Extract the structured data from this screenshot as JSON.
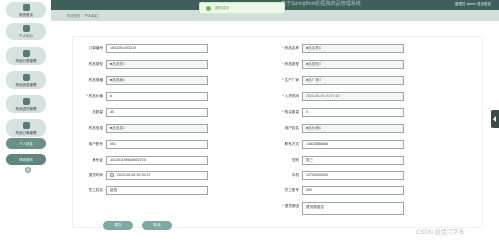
{
  "app": {
    "title": "基于SpringBoot的医院药品管理系统"
  },
  "topbar": {
    "right_text": "管理员 admin  退出登录"
  },
  "breadcrumb": {
    "home": "系统首页",
    "current": "个人中心"
  },
  "toast": {
    "message": "操作成功"
  },
  "sidebar": {
    "items": [
      {
        "label": "系统首页",
        "icon": "home-icon"
      },
      {
        "label": "个人中心",
        "icon": "user-icon"
      },
      {
        "label": "药品分类管理",
        "icon": "category-icon"
      },
      {
        "label": "药品信息管理",
        "icon": "medicine-icon"
      },
      {
        "label": "药品进货管理",
        "icon": "stock-icon"
      },
      {
        "label": "药品订单管理",
        "icon": "order-icon"
      }
    ],
    "sub_items": [
      {
        "label": "个人信息"
      },
      {
        "label": "修改密码"
      }
    ]
  },
  "form": {
    "left": [
      {
        "label": "订单编号",
        "value": "1603201403219",
        "disabled": false
      },
      {
        "label": "药品类型",
        "value": "■品类型1",
        "disabled": true
      },
      {
        "label": "药品规格",
        "value": "■品规格1",
        "disabled": true
      },
      {
        "label": "* 药品价格",
        "value": "6",
        "disabled": false
      },
      {
        "label": "总数量",
        "value": "30",
        "disabled": false
      },
      {
        "label": "药品信息",
        "value": "■品信息1",
        "disabled": true
      },
      {
        "label": "用户账号",
        "value": "001",
        "disabled": false
      },
      {
        "label": "身份证",
        "value": "441301199605002710",
        "disabled": false
      },
      {
        "label": "退货时间",
        "value": "2023-05-05 20:39:37",
        "disabled": false,
        "calendar": true
      },
      {
        "label": "员工姓名",
        "value": "赵四",
        "disabled": false
      }
    ],
    "right": [
      {
        "label": "* 药品名称",
        "value": "■品名称6",
        "disabled": true
      },
      {
        "label": "* 药品类型",
        "value": "■品类型4",
        "disabled": true
      },
      {
        "label": "* 生产厂家",
        "value": "■品厂家4",
        "disabled": true
      },
      {
        "label": "* 入货时间",
        "value": "2023-05-05 20:57:43",
        "disabled": true
      },
      {
        "label": "* 购买数量",
        "value": "5",
        "disabled": false
      },
      {
        "label": "用户姓名",
        "value": "■品价格6",
        "disabled": true
      },
      {
        "label": "联系方式",
        "value": "13823888888",
        "disabled": false
      },
      {
        "label": "性别",
        "value": "张三",
        "disabled": false
      },
      {
        "label": "手机",
        "value": "13700000000",
        "disabled": false
      },
      {
        "label": "员工账号",
        "value": "000",
        "disabled": false
      },
      {
        "label": "* 退货原因",
        "value": "退货原因否",
        "disabled": false,
        "textarea": true
      }
    ]
  },
  "buttons": {
    "submit": "提交",
    "cancel": "取消"
  },
  "watermark": "CSDN @佳汀学长"
}
